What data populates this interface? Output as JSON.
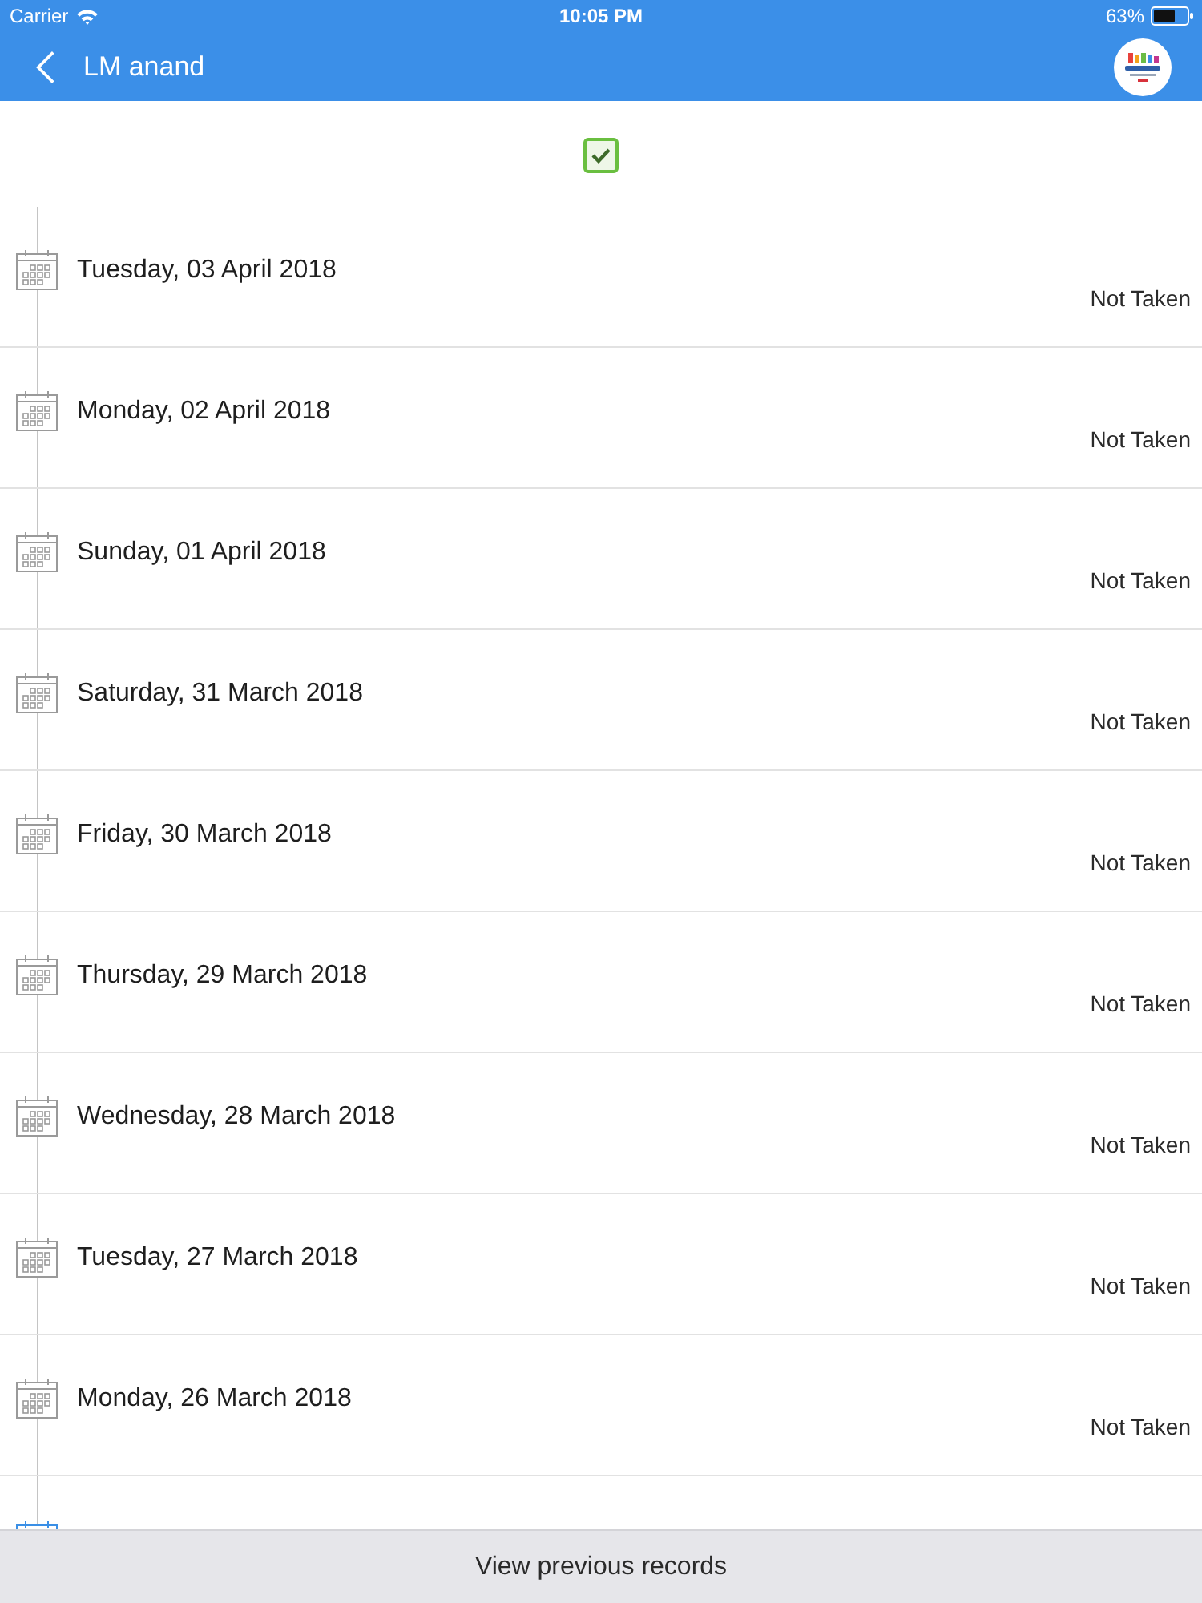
{
  "status_bar": {
    "carrier": "Carrier",
    "time": "10:05 PM",
    "battery": "63%"
  },
  "nav_bar": {
    "title": "LM anand"
  },
  "checkbox": {
    "checked": true
  },
  "rows": [
    {
      "date": "Tuesday, 03 April 2018",
      "status": "Not Taken"
    },
    {
      "date": "Monday, 02 April 2018",
      "status": "Not Taken"
    },
    {
      "date": "Sunday, 01 April 2018",
      "status": "Not Taken"
    },
    {
      "date": "Saturday, 31 March 2018",
      "status": "Not Taken"
    },
    {
      "date": "Friday, 30 March 2018",
      "status": "Not Taken"
    },
    {
      "date": "Thursday, 29 March 2018",
      "status": "Not Taken"
    },
    {
      "date": "Wednesday, 28 March 2018",
      "status": "Not Taken"
    },
    {
      "date": "Tuesday, 27 March 2018",
      "status": "Not Taken"
    },
    {
      "date": "Monday, 26 March 2018",
      "status": "Not Taken"
    }
  ],
  "hidden_row": {
    "highlighted": true
  },
  "footer": {
    "button": "View previous records"
  }
}
